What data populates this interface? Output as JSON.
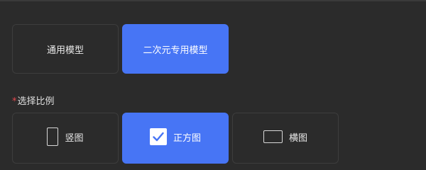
{
  "model_options": [
    {
      "label": "通用模型",
      "selected": false
    },
    {
      "label": "二次元专用模型",
      "selected": true
    }
  ],
  "ratio_section": {
    "required_mark": "*",
    "label": "选择比例"
  },
  "ratio_options": [
    {
      "label": "竖图",
      "icon": "portrait-frame-icon",
      "selected": false
    },
    {
      "label": "正方图",
      "icon": "checkbox-checked-icon",
      "selected": true
    },
    {
      "label": "横图",
      "icon": "landscape-frame-icon",
      "selected": false
    }
  ],
  "colors": {
    "background": "#2b2b2b",
    "accent": "#4775f5",
    "required": "#e5484d"
  }
}
